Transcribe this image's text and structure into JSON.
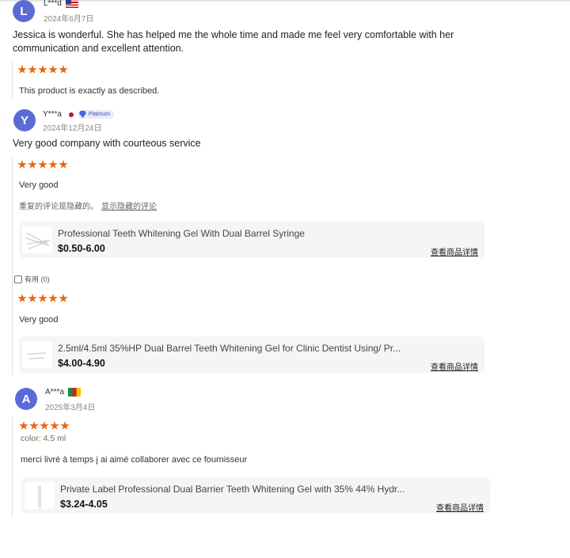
{
  "colors": {
    "star": "#e8650f",
    "avatar": "#5b6bd6",
    "card_bg": "#f5f5f5"
  },
  "reviews": [
    {
      "avatar": "L",
      "name": "L***d",
      "flag": "us-flag-icon",
      "date": "2024年6月7日",
      "text": "Jessica is wonderful. She has helped me the whole time and made me feel very comfortable with her communication and excellent attention.",
      "rating": 5,
      "product_comment": "This product is exactly as described."
    },
    {
      "avatar": "Y",
      "name": "Y***a",
      "badge": "Platinum",
      "date": "2024年12月24日",
      "text": "Very good company with courteous service",
      "items": [
        {
          "rating": 5,
          "comment": "Very good",
          "hidden_note": "重复的评论是隐藏的。",
          "hidden_link": "显示隐藏的评论",
          "product": {
            "title": "Professional Teeth Whitening Gel With Dual Barrel Syringe",
            "price": "$0.50-6.00",
            "link": "查看商品详情"
          },
          "helpful": "有用 (0)"
        },
        {
          "rating": 5,
          "comment": "Very good",
          "product": {
            "title": "2.5ml/4.5ml 35%HP Dual Barrel Teeth Whitening Gel for Clinic Dentist Using/ Pr...",
            "price": "$4.00-4.90",
            "link": "查看商品详情"
          }
        }
      ]
    },
    {
      "avatar": "A",
      "name": "A***a",
      "flag": "cameroon-flag-icon",
      "date": "2025年3月4日",
      "rating": 5,
      "color_label": "color: 4.5 ml",
      "text": "merci livré à temps j ai aimé collaborer avec ce fournisseur",
      "product": {
        "title": "Private Label Professional Dual Barrier Teeth Whitening Gel with 35% 44% Hydr...",
        "price": "$3.24-4.05",
        "link": "查看商品详情"
      }
    }
  ]
}
